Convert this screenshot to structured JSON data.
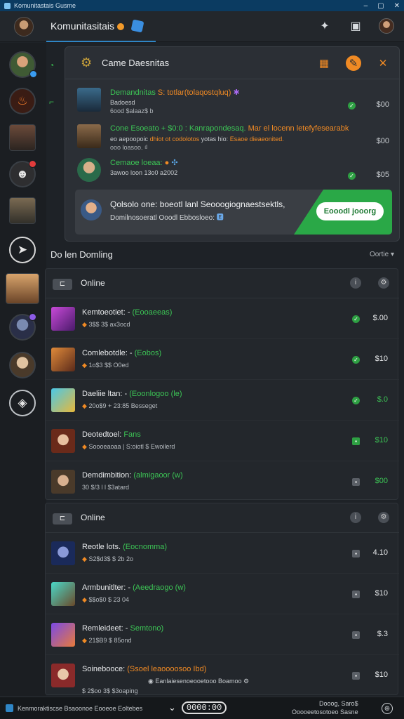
{
  "window": {
    "title": "Komunitastais Gusme"
  },
  "header": {
    "title": "Komunitasitais",
    "icons": [
      "puzzle-icon",
      "gift-icon",
      "user-avatar"
    ]
  },
  "sidebar": {
    "items": [
      {
        "name": "sidebar-item-profile",
        "icon": "avatar"
      },
      {
        "name": "sidebar-item-hero",
        "icon": "flame-icon"
      },
      {
        "name": "sidebar-item-character",
        "icon": "avatar"
      },
      {
        "name": "sidebar-item-mask",
        "icon": "mask-icon"
      },
      {
        "name": "sidebar-item-soldier",
        "icon": "avatar"
      },
      {
        "name": "sidebar-item-compass",
        "icon": "compass-icon"
      },
      {
        "name": "sidebar-item-warrior",
        "icon": "avatar"
      },
      {
        "name": "sidebar-item-knight",
        "icon": "avatar"
      },
      {
        "name": "sidebar-item-alien",
        "icon": "avatar"
      },
      {
        "name": "sidebar-item-add",
        "icon": "compass-icon"
      }
    ]
  },
  "panel": {
    "title": "Came Daesnitas",
    "notifications": [
      {
        "l1a": "Demandnitas",
        "l1b": "S: totlar(tolaqostqluq)",
        "l1c": "✱",
        "l2": "Badoesd",
        "l3": "6ood $alaaz$ b",
        "value": "$00"
      },
      {
        "l1a": "Cone Esoeato + $0:0 : Kanrapondesaq.",
        "l1b": "Mar el locenn letefyfesearabk",
        "l2a": "eo aepoopoic",
        "l2b": "dhiot ot codolotos",
        "l2c": "yotas hio: ",
        "l2d": "Esaoe dieaeonited.",
        "l3": "ooo loasoo. ₫",
        "value": "$00"
      },
      {
        "l1a": "Cemaoe loeaa:",
        "l2": "3awoo loon 13o0 a2002",
        "value": "$05"
      }
    ],
    "banner": {
      "line1": "Qolsolo one: boeotl lanl Seooogiognaestsektls,",
      "line2": "Domilnosoeratl Ooodl Ebbosloeo: ",
      "tag": "🅴",
      "button": "Eooodl jooorg"
    }
  },
  "section": {
    "title": "Do len Domling",
    "sort": "Oortie"
  },
  "groups": [
    {
      "label": "Online",
      "rows": [
        {
          "name": "Kemtoeotiet: -",
          "status": "(Eooaeeas)",
          "sub": "3$$ 3$ ax3ocd",
          "value": "$.00",
          "check": "green"
        },
        {
          "name": "Comlebotdle: -",
          "status": "(Eobos)",
          "sub": "1o$3 $$ O0ed",
          "value": "$10",
          "check": "green"
        },
        {
          "name": "Daeliie ltan: -",
          "status": "(Eoonlogoo (le)",
          "sub": "20o$9 + 23:85 Besseget",
          "value": "$.0",
          "check": "green"
        },
        {
          "name": "Deotedtoel: ",
          "status": "Fans",
          "sub": "Soooeaoaa | S:oiotl $ Ewoilerd",
          "value": "$10",
          "check": "square"
        },
        {
          "name": "Demdimbition:",
          "status": "(almigaoor (w)",
          "sub": "30 $/3 l l $3atard",
          "value": "$00",
          "check": "square"
        }
      ]
    },
    {
      "label": "Online",
      "rows": [
        {
          "name": "Reotle lots.",
          "status": "(Eocnomma)",
          "sub": "S2$d3$ $ 2b 2o",
          "value": "4.10",
          "check": "square"
        },
        {
          "name": "Armbunitlter: -",
          "status": "(Aeedraogo (w)",
          "sub": "$$o$0 $ 23 04",
          "value": "$10",
          "check": "square"
        },
        {
          "name": "Remleideet: -",
          "status": "Semtono)",
          "sub": "21$B9 $ 85ond",
          "value": "$.3",
          "check": "square"
        },
        {
          "name": "Soinebooce:",
          "status": "(Ssoel leaoooosoo Ibd)",
          "mid": "Eanlaiesenoeooetooo Boamoo",
          "sub": "$ 2$oo 3$ $3oaping",
          "value": "$10",
          "check": "square"
        }
      ]
    }
  ],
  "footer": {
    "left": "Kenmoraktiscse Bsaoonoe Eooeoe Eoltebes",
    "clock": "0000:00",
    "right1": "Dooog, Saro$",
    "right2": "Ooooeetosotoeo Sasne"
  }
}
